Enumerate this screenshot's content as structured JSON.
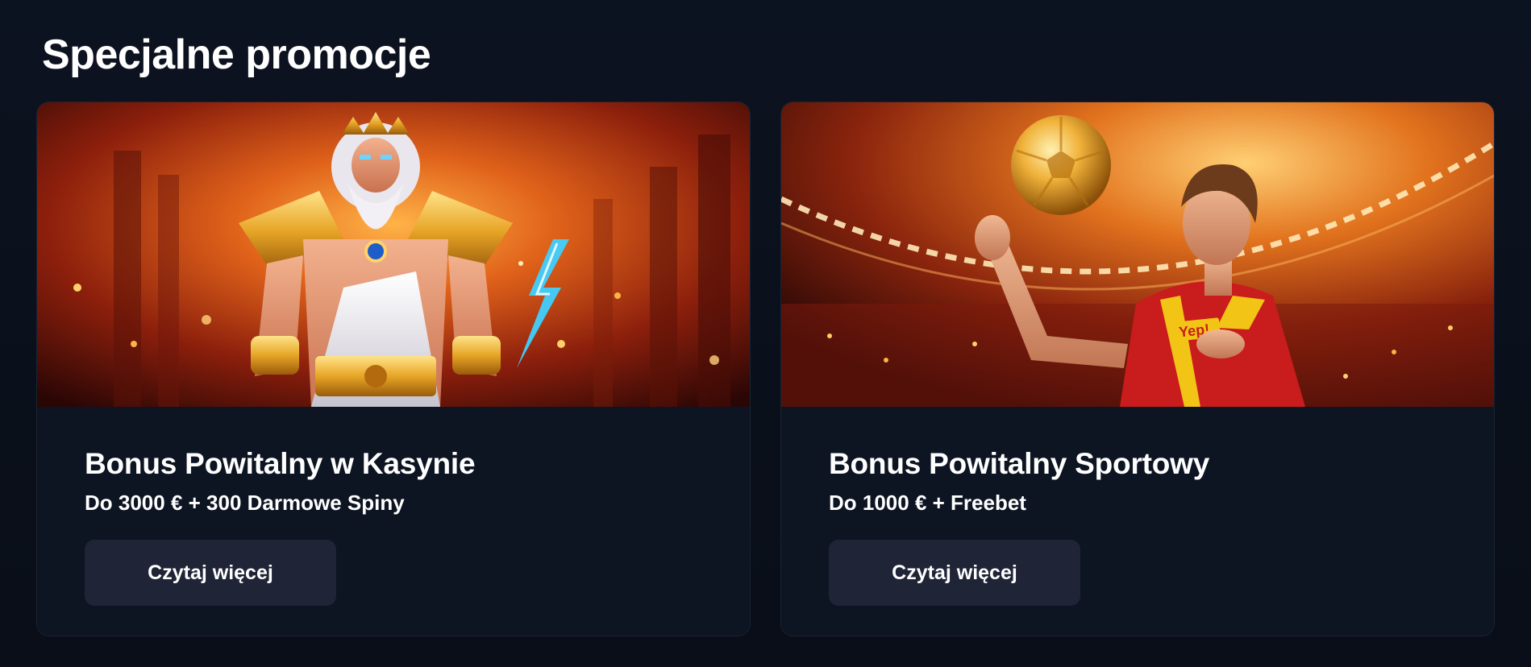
{
  "section": {
    "title": "Specjalne promocje"
  },
  "promotions": [
    {
      "title": "Bonus Powitalny w Kasynie",
      "subtitle": "Do 3000 € + 300 Darmowe Spiny",
      "button_label": "Czytaj więcej",
      "image_alt": "casino-zeus-banner"
    },
    {
      "title": "Bonus Powitalny Sportowy",
      "subtitle": "Do 1000 € + Freebet",
      "button_label": "Czytaj więcej",
      "image_alt": "sports-football-banner",
      "jersey_logo": "Yep!"
    }
  ],
  "colors": {
    "page_background": "#0a101b",
    "card_background": "#0d1422",
    "button_background": "#1f2436",
    "text": "#ffffff"
  }
}
